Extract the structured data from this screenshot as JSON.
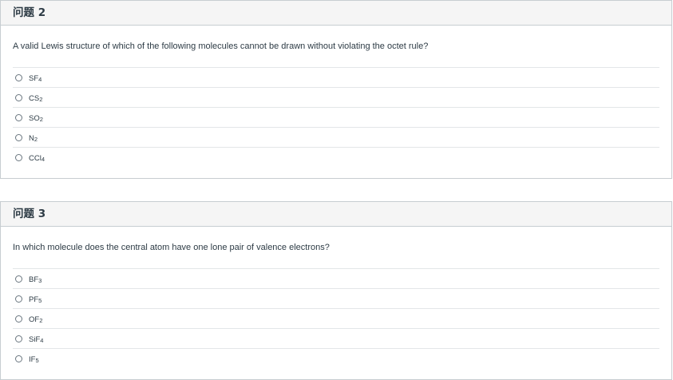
{
  "questions": [
    {
      "title": "问题 2",
      "text": "A valid Lewis structure of which of the following molecules cannot be drawn without violating the octet rule?",
      "answers": [
        {
          "base": "SF",
          "sub": "4"
        },
        {
          "base": "CS",
          "sub": "2"
        },
        {
          "base": "SO",
          "sub": "2"
        },
        {
          "base": "N",
          "sub": "2"
        },
        {
          "base": "CCl",
          "sub": "4"
        }
      ]
    },
    {
      "title": "问题 3",
      "text": "In which molecule does the central atom have one lone pair of valence electrons?",
      "answers": [
        {
          "base": "BF",
          "sub": "3"
        },
        {
          "base": "PF",
          "sub": "5"
        },
        {
          "base": "OF",
          "sub": "2"
        },
        {
          "base": "SiF",
          "sub": "4"
        },
        {
          "base": "IF",
          "sub": "5"
        }
      ]
    }
  ]
}
